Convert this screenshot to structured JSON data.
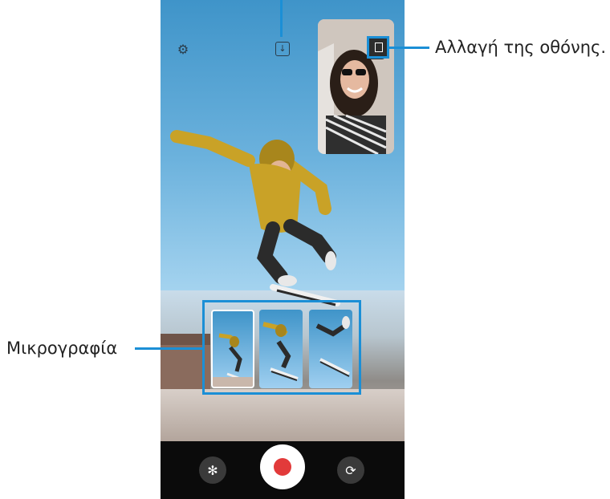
{
  "callouts": {
    "switch_screen": "Αλλαγή της οθόνης.",
    "thumbnail": "Μικρογραφία"
  },
  "icons": {
    "settings": "⚙",
    "save": "↓",
    "effects": "✻",
    "switch_camera": "⟳"
  },
  "colors": {
    "accent": "#1b8fd6",
    "record": "#e23a3a",
    "sky": "#5aa7d8"
  }
}
